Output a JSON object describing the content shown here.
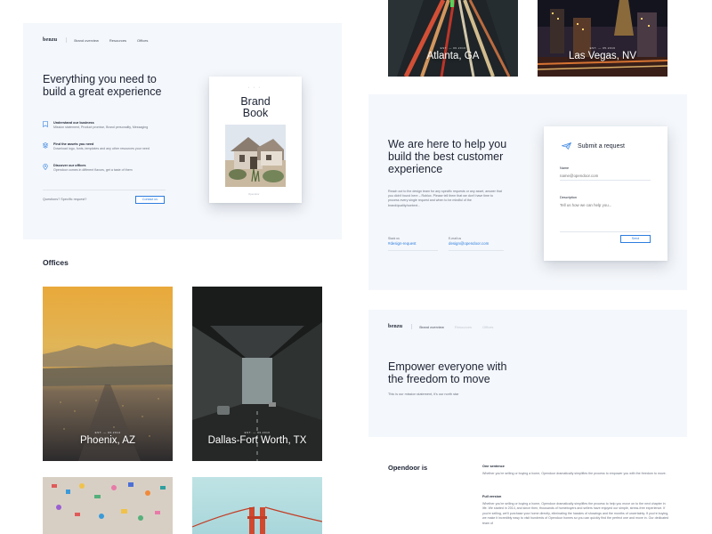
{
  "brand_card": {
    "logo": "benzu",
    "nav": [
      "Brand overview",
      "Resources",
      "Offices"
    ],
    "title": "Everything you need to build a great experience",
    "features": [
      {
        "icon": "bookmark-icon",
        "title": "Understand our business",
        "desc": "Mission statement, Product promise, Brand personality, Messaging"
      },
      {
        "icon": "layers-icon",
        "title": "Find the assets you need",
        "desc": "Download logo, fonts, templates and any other resources your need"
      },
      {
        "icon": "location-pin-icon",
        "title": "Discover our offices",
        "desc": "Opendoor comes in different flavors, get a taste of them"
      }
    ],
    "questions": "Questions? Specific request?",
    "contact_button": "Contact us",
    "book": {
      "dots": "• • •",
      "title_line1": "Brand",
      "title_line2": "Book",
      "footer": "Opendoor"
    }
  },
  "offices": {
    "title": "Offices",
    "items": [
      {
        "city": "Phoenix, AZ",
        "date": "EST. — 03.2014"
      },
      {
        "city": "Dallas-Fort Worth, TX",
        "date": "EST. — 03.2016"
      },
      {
        "city": "Atlanta, GA",
        "date": "EST. — 06.2016"
      },
      {
        "city": "Las Vegas, NV",
        "date": "EST. — 05.2016"
      }
    ]
  },
  "help_card": {
    "title": "We are here to help you build the best customer experience",
    "body": "Reach out to the design team for any specific requests or any asset, answer that you didn't found here – Roblox. Please tell them that we don't have time to process every single request and when to be mindful of the brand/quality/context...",
    "slack_label": "Slack us",
    "slack_value": "#design-request",
    "email_label": "E-mail us",
    "email_value": "design@opendoor.com",
    "form": {
      "title": "Submit a request",
      "name_label": "Name",
      "name_placeholder": "name@opendoor.com",
      "desc_label": "Description",
      "desc_placeholder": "Tell us how we can help you...",
      "send": "Send"
    }
  },
  "mission_card": {
    "logo": "benzu",
    "nav": [
      "Brand overview",
      "Resources",
      "Offices"
    ],
    "title": "Empower everyone with the freedom to move",
    "subtitle": "This is our mission statement, it's our north star"
  },
  "opendoor": {
    "title": "Opendoor is",
    "one_sentence_label": "One sentence",
    "one_sentence": "Whether you're selling or buying a home, Opendoor dramatically simplifies the process to empower you with the freedom to move.",
    "full_version_label": "Full version",
    "full_version": "Whether you're selling or buying a home, Opendoor dramatically simplifies the process to help you move on to the next chapter in life. We started in 2014, and since then, thousands of homebuyers and sellers have enjoyed our simple, stress-free experience. If you're selling, we'll purchase your home directly, eliminating the hassles of showings and the months of uncertainty. If you're buying, we make it incredibly easy to visit hundreds of Opendoor homes so you can quickly find the perfect one and move in. Our dedicated team of"
  },
  "colors": {
    "accent": "#2d7de0",
    "panel": "#f4f7fb",
    "text": "#1c2333",
    "muted": "#6b7280"
  }
}
